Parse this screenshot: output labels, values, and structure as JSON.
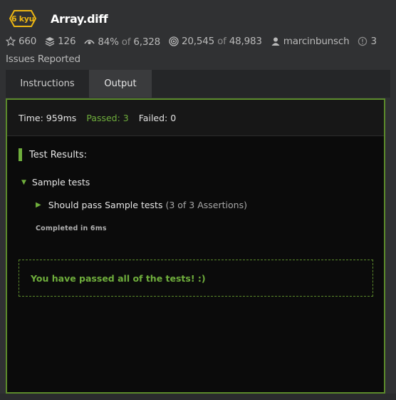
{
  "kata": {
    "rank": "6 kyu",
    "title": "Array.diff"
  },
  "stats": {
    "stars": "660",
    "collections": "126",
    "satisfaction": "84%",
    "satisfaction_of": "of",
    "votes": "6,328",
    "completions": "20,545",
    "completions_of": "of",
    "attempts": "48,983",
    "author": "marcinbunsch",
    "issues": "3",
    "issues_label": "Issues Reported"
  },
  "tabs": [
    {
      "label": "Instructions",
      "active": false
    },
    {
      "label": "Output",
      "active": true
    }
  ],
  "output": {
    "time": "Time: 959ms",
    "passed": "Passed: 3",
    "failed": "Failed: 0",
    "results_heading": "Test Results:",
    "group_label": "Sample tests",
    "test_label": "Should pass Sample tests",
    "test_count": "(3 of 3 Assertions)",
    "completed": "Completed in 6ms",
    "success_message": "You have passed all of the tests! :)"
  },
  "colors": {
    "accent_green": "#6fae3c",
    "rank_yellow": "#ecb613",
    "border_green": "#5b8a2b"
  },
  "icons": [
    "star-icon",
    "stack-icon",
    "eye-icon",
    "target-icon",
    "user-icon",
    "alert-icon",
    "triangle-down-icon",
    "triangle-right-icon"
  ]
}
